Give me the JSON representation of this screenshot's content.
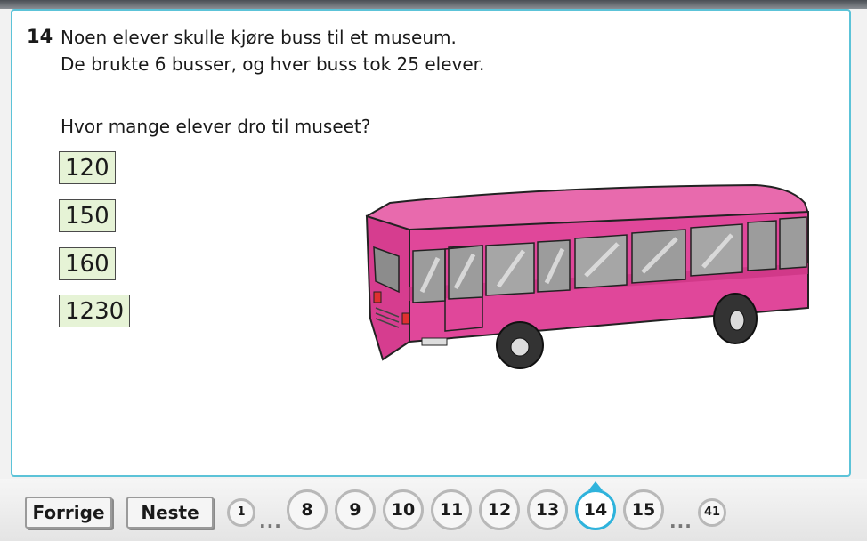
{
  "question": {
    "number": "14",
    "line1": "Noen elever skulle kjøre buss til et museum.",
    "line2": "De brukte 6 busser, og hver buss tok 25 elever.",
    "prompt": "Hvor mange elever dro til museet?"
  },
  "options": [
    "120",
    "150",
    "160",
    "1230"
  ],
  "navigation": {
    "prev_label": "Forrige",
    "next_label": "Neste",
    "ellipsis": "...",
    "pages": [
      "1",
      "8",
      "9",
      "10",
      "11",
      "12",
      "13",
      "14",
      "15",
      "41"
    ],
    "current_page": "14"
  },
  "colors": {
    "panel_border": "#5cc3d8",
    "option_bg": "#e6f3d6",
    "current_page_ring": "#2fb3dc",
    "bus_body": "#e0479a"
  },
  "image": {
    "icon": "pink-bus-illustration"
  }
}
